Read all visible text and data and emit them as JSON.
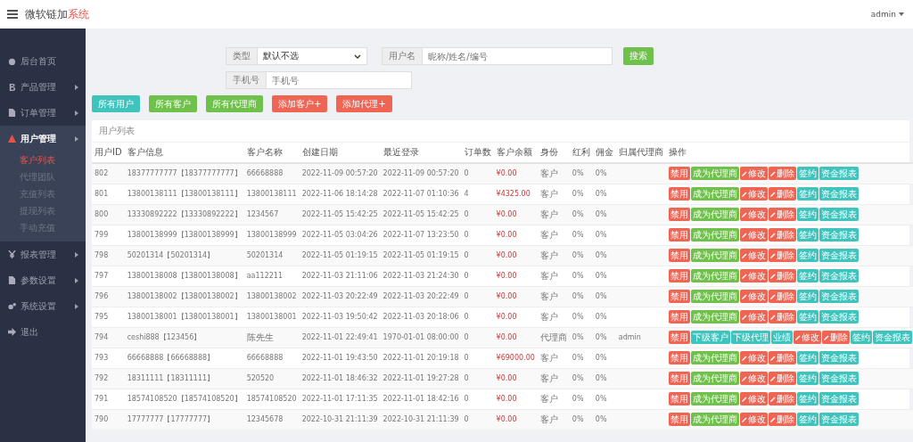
{
  "header": {
    "brand": "微软链加",
    "brand_suffix": "系统",
    "user": "admin"
  },
  "sidebar": {
    "items": [
      {
        "label": "后台首页",
        "submenu": false,
        "selected": false
      },
      {
        "label": "产品管理",
        "submenu": true,
        "selected": false
      },
      {
        "label": "订单管理",
        "submenu": true,
        "selected": false
      },
      {
        "label": "用户管理",
        "submenu": true,
        "expanded": true,
        "selected": true,
        "children": [
          {
            "label": "客户列表",
            "selected": true
          },
          {
            "label": "代理团队",
            "selected": false
          },
          {
            "label": "充值列表",
            "selected": false
          },
          {
            "label": "提现列表",
            "selected": false
          },
          {
            "label": "手动充值",
            "selected": false
          }
        ]
      },
      {
        "label": "报表管理",
        "submenu": true,
        "selected": false
      },
      {
        "label": "参数设置",
        "submenu": true,
        "selected": false
      },
      {
        "label": "系统设置",
        "submenu": true,
        "selected": false
      },
      {
        "label": "退出",
        "submenu": false,
        "selected": false
      }
    ]
  },
  "filters": {
    "type_label": "类型",
    "type_value": "默认不选",
    "user_label": "用户名",
    "user_placeholder": "昵称/姓名/编号",
    "search": "搜索",
    "phone_label": "手机号",
    "phone_placeholder": "手机号"
  },
  "toolbar": [
    {
      "label": "所有用户",
      "kind": "info"
    },
    {
      "label": "所有客户",
      "kind": "success"
    },
    {
      "label": "所有代理商",
      "kind": "success"
    },
    {
      "label": "添加客户+",
      "kind": "danger"
    },
    {
      "label": "添加代理+",
      "kind": "danger"
    }
  ],
  "table": {
    "title": "用户列表",
    "columns": [
      "用户ID",
      "客户信息",
      "客户名称",
      "创建日期",
      "最近登录",
      "订单数",
      "客户余额",
      "身份",
      "红利",
      "佣金",
      "归属代理商",
      "操作"
    ],
    "rows": [
      {
        "id": "802",
        "info": "18377777777【18377777777】",
        "name": "66668888",
        "created": "2022-11-09 00:57:20",
        "login": "2022-11-09 00:57:20",
        "orders": "0",
        "balance": "¥0.00",
        "role": "客户",
        "bonus": "0%",
        "commission": "0%",
        "actions": [
          {
            "label": "禁用",
            "kind": "danger"
          },
          {
            "label": "成为代理商",
            "kind": "success"
          },
          {
            "label": "修改",
            "kind": "edit"
          },
          {
            "label": "删除",
            "kind": "edit"
          },
          {
            "label": "签约",
            "kind": "info"
          },
          {
            "label": "资金报表",
            "kind": "info"
          }
        ]
      },
      {
        "id": "801",
        "info": "13800138111【13800138111】",
        "name": "13800138111",
        "created": "2022-11-06 18:14:28",
        "login": "2022-11-07 01:10:36",
        "orders": "4",
        "balance": "¥4325.00",
        "role": "客户",
        "bonus": "0%",
        "commission": "0%",
        "actions": [
          {
            "label": "禁用",
            "kind": "danger"
          },
          {
            "label": "成为代理商",
            "kind": "success"
          },
          {
            "label": "修改",
            "kind": "edit"
          },
          {
            "label": "删除",
            "kind": "edit"
          },
          {
            "label": "签约",
            "kind": "info"
          },
          {
            "label": "资金报表",
            "kind": "info"
          }
        ]
      },
      {
        "id": "800",
        "info": "13330892222【13330892222】",
        "name": "1234567",
        "created": "2022-11-05 15:42:25",
        "login": "2022-11-05 15:42:25",
        "orders": "0",
        "balance": "¥0.00",
        "role": "客户",
        "bonus": "0%",
        "commission": "0%",
        "actions": [
          {
            "label": "禁用",
            "kind": "danger"
          },
          {
            "label": "成为代理商",
            "kind": "success"
          },
          {
            "label": "修改",
            "kind": "edit"
          },
          {
            "label": "删除",
            "kind": "edit"
          },
          {
            "label": "签约",
            "kind": "info"
          },
          {
            "label": "资金报表",
            "kind": "info"
          }
        ]
      },
      {
        "id": "799",
        "info": "13800138999【13800138999】",
        "name": "13800138999",
        "created": "2022-11-05 03:04:26",
        "login": "2022-11-07 13:23:50",
        "orders": "0",
        "balance": "¥0.00",
        "role": "客户",
        "bonus": "0%",
        "commission": "0%",
        "actions": [
          {
            "label": "禁用",
            "kind": "danger"
          },
          {
            "label": "成为代理商",
            "kind": "success"
          },
          {
            "label": "修改",
            "kind": "edit"
          },
          {
            "label": "删除",
            "kind": "edit"
          },
          {
            "label": "签约",
            "kind": "info"
          },
          {
            "label": "资金报表",
            "kind": "info"
          }
        ]
      },
      {
        "id": "798",
        "info": "50201314【50201314】",
        "name": "50201314",
        "created": "2022-11-05 01:19:15",
        "login": "2022-11-05 01:19:15",
        "orders": "0",
        "balance": "¥0.00",
        "role": "客户",
        "bonus": "0%",
        "commission": "0%",
        "actions": [
          {
            "label": "禁用",
            "kind": "danger"
          },
          {
            "label": "成为代理商",
            "kind": "success"
          },
          {
            "label": "修改",
            "kind": "edit"
          },
          {
            "label": "删除",
            "kind": "edit"
          },
          {
            "label": "签约",
            "kind": "info"
          },
          {
            "label": "资金报表",
            "kind": "info"
          }
        ]
      },
      {
        "id": "797",
        "info": "13800138008【13800138008】",
        "name": "aa112211",
        "created": "2022-11-03 21:11:06",
        "login": "2022-11-03 21:24:30",
        "orders": "0",
        "balance": "¥0.00",
        "role": "客户",
        "bonus": "0%",
        "commission": "0%",
        "actions": [
          {
            "label": "禁用",
            "kind": "danger"
          },
          {
            "label": "成为代理商",
            "kind": "success"
          },
          {
            "label": "修改",
            "kind": "edit"
          },
          {
            "label": "删除",
            "kind": "edit"
          },
          {
            "label": "签约",
            "kind": "info"
          },
          {
            "label": "资金报表",
            "kind": "info"
          }
        ]
      },
      {
        "id": "796",
        "info": "13800138002【13800138002】",
        "name": "13800138002",
        "created": "2022-11-03 20:22:49",
        "login": "2022-11-03 20:22:49",
        "orders": "0",
        "balance": "¥0.00",
        "role": "客户",
        "bonus": "0%",
        "commission": "0%",
        "actions": [
          {
            "label": "禁用",
            "kind": "danger"
          },
          {
            "label": "成为代理商",
            "kind": "success"
          },
          {
            "label": "修改",
            "kind": "edit"
          },
          {
            "label": "删除",
            "kind": "edit"
          },
          {
            "label": "签约",
            "kind": "info"
          },
          {
            "label": "资金报表",
            "kind": "info"
          }
        ]
      },
      {
        "id": "795",
        "info": "13800138001【13800138001】",
        "name": "13800138001",
        "created": "2022-11-03 19:50:42",
        "login": "2022-11-03 20:18:06",
        "orders": "0",
        "balance": "¥0.00",
        "role": "客户",
        "bonus": "0%",
        "commission": "0%",
        "actions": [
          {
            "label": "禁用",
            "kind": "danger"
          },
          {
            "label": "成为代理商",
            "kind": "success"
          },
          {
            "label": "修改",
            "kind": "edit"
          },
          {
            "label": "删除",
            "kind": "edit"
          },
          {
            "label": "签约",
            "kind": "info"
          },
          {
            "label": "资金报表",
            "kind": "info"
          }
        ]
      },
      {
        "id": "794",
        "info": "ceshi888【123456】",
        "name": "陈先生",
        "created": "2022-11-01 22:49:41",
        "login": "1970-01-01 08:00:00",
        "orders": "0",
        "balance": "¥0.00",
        "role": "代理商",
        "bonus": "0%",
        "commission": "0%",
        "agent": "admin",
        "actions": [
          {
            "label": "禁用",
            "kind": "danger"
          },
          {
            "label": "下级客户",
            "kind": "info"
          },
          {
            "label": "下级代理",
            "kind": "info"
          },
          {
            "label": "业绩",
            "kind": "info"
          },
          {
            "label": "修改",
            "kind": "edit"
          },
          {
            "label": "删除",
            "kind": "edit"
          },
          {
            "label": "签约",
            "kind": "info"
          },
          {
            "label": "资金报表",
            "kind": "info"
          }
        ]
      },
      {
        "id": "793",
        "info": "66668888【66668888】",
        "name": "66668888",
        "created": "2022-11-01 19:43:50",
        "login": "2022-11-01 20:19:18",
        "orders": "0",
        "balance": "¥69000.00",
        "role": "客户",
        "bonus": "0%",
        "commission": "0%",
        "actions": [
          {
            "label": "禁用",
            "kind": "danger"
          },
          {
            "label": "成为代理商",
            "kind": "success"
          },
          {
            "label": "修改",
            "kind": "edit"
          },
          {
            "label": "删除",
            "kind": "edit"
          },
          {
            "label": "签约",
            "kind": "info"
          },
          {
            "label": "资金报表",
            "kind": "info"
          }
        ]
      },
      {
        "id": "792",
        "info": "18311111【18311111】",
        "name": "520520",
        "created": "2022-11-01 18:46:32",
        "login": "2022-11-01 19:27:28",
        "orders": "0",
        "balance": "¥0.00",
        "role": "客户",
        "bonus": "0%",
        "commission": "0%",
        "actions": [
          {
            "label": "禁用",
            "kind": "danger"
          },
          {
            "label": "成为代理商",
            "kind": "success"
          },
          {
            "label": "修改",
            "kind": "edit"
          },
          {
            "label": "删除",
            "kind": "edit"
          },
          {
            "label": "签约",
            "kind": "info"
          },
          {
            "label": "资金报表",
            "kind": "info"
          }
        ]
      },
      {
        "id": "791",
        "info": "18574108520【18574108520】",
        "name": "18574108520",
        "created": "2022-11-01 17:11:35",
        "login": "2022-11-01 18:42:16",
        "orders": "0",
        "balance": "¥0.00",
        "role": "客户",
        "bonus": "0%",
        "commission": "0%",
        "actions": [
          {
            "label": "禁用",
            "kind": "danger"
          },
          {
            "label": "成为代理商",
            "kind": "success"
          },
          {
            "label": "修改",
            "kind": "edit"
          },
          {
            "label": "删除",
            "kind": "edit"
          },
          {
            "label": "签约",
            "kind": "info"
          },
          {
            "label": "资金报表",
            "kind": "info"
          }
        ]
      },
      {
        "id": "790",
        "info": "17777777【17777777】",
        "name": "12345678",
        "created": "2022-10-31 21:11:39",
        "login": "2022-10-31 21:11:39",
        "orders": "0",
        "balance": "¥0.00",
        "role": "客户",
        "bonus": "0%",
        "commission": "0%",
        "actions": [
          {
            "label": "禁用",
            "kind": "danger"
          },
          {
            "label": "成为代理商",
            "kind": "success"
          },
          {
            "label": "修改",
            "kind": "edit"
          },
          {
            "label": "删除",
            "kind": "edit"
          },
          {
            "label": "签约",
            "kind": "info"
          },
          {
            "label": "资金报表",
            "kind": "info"
          }
        ]
      }
    ]
  }
}
